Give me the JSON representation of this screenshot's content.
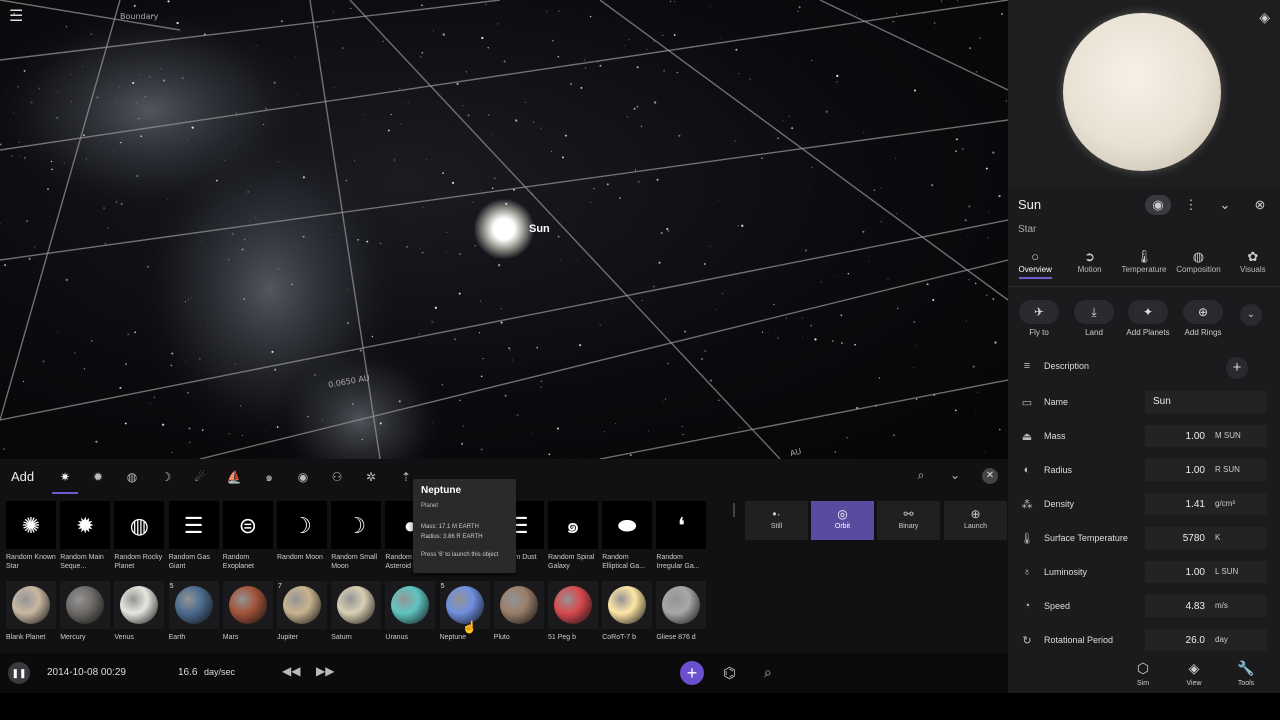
{
  "viewport": {
    "sun_label": "Sun",
    "grid_label_a": "0.0650 AU",
    "grid_label_b": "AU",
    "grid_label_c": "Boundary"
  },
  "panel": {
    "title": "Sun",
    "type": "Star",
    "tabs": [
      {
        "label": "Overview",
        "icon": "circle-icon"
      },
      {
        "label": "Motion",
        "icon": "motion-icon"
      },
      {
        "label": "Temperature",
        "icon": "thermometer-icon"
      },
      {
        "label": "Composition",
        "icon": "composition-icon"
      },
      {
        "label": "Visuals",
        "icon": "palette-icon"
      }
    ],
    "actions": [
      {
        "label": "Fly to",
        "icon": "plane-icon"
      },
      {
        "label": "Land",
        "icon": "land-icon"
      },
      {
        "label": "Add Planets",
        "icon": "add-planets-icon"
      },
      {
        "label": "Add Rings",
        "icon": "add-rings-icon"
      }
    ],
    "description_label": "Description",
    "properties": [
      {
        "label": "Name",
        "value": "Sun",
        "unit": ""
      },
      {
        "label": "Mass",
        "value": "1.00",
        "unit": "M SUN"
      },
      {
        "label": "Radius",
        "value": "1.00",
        "unit": "R SUN"
      },
      {
        "label": "Density",
        "value": "1.41",
        "unit": "g/cm³"
      },
      {
        "label": "Surface Temperature",
        "value": "5780",
        "unit": "K"
      },
      {
        "label": "Luminosity",
        "value": "1.00",
        "unit": "L SUN"
      },
      {
        "label": "Speed",
        "value": "4.83",
        "unit": "m/s"
      },
      {
        "label": "Rotational Period",
        "value": "26.0",
        "unit": "day"
      }
    ]
  },
  "tray": {
    "title": "Add",
    "row1": [
      {
        "label": "Random Known Star",
        "glyph": "✺"
      },
      {
        "label": "Random Main Seque...",
        "glyph": "✹"
      },
      {
        "label": "Random Rocky Planet",
        "glyph": "◍"
      },
      {
        "label": "Random Gas Giant",
        "glyph": "☰"
      },
      {
        "label": "Random Exoplanet",
        "glyph": "⊜"
      },
      {
        "label": "Random Moon",
        "glyph": "☽"
      },
      {
        "label": "Random Small Moon",
        "glyph": "☽"
      },
      {
        "label": "Random Asteroid",
        "glyph": "●"
      },
      {
        "label": "",
        "glyph": ""
      },
      {
        "label": "Random Dust",
        "glyph": "☰"
      },
      {
        "label": "Random Spiral Galaxy",
        "glyph": "๑"
      },
      {
        "label": "Random Elliptical Ga...",
        "glyph": "⬬"
      },
      {
        "label": "Random Irregular Ga...",
        "glyph": "❛"
      }
    ],
    "row2": [
      {
        "label": "Blank Planet",
        "color": "#c9b8a3",
        "num": ""
      },
      {
        "label": "Mercury",
        "color": "#6d6a66",
        "num": ""
      },
      {
        "label": "Venus",
        "color": "#e8e6e0",
        "num": ""
      },
      {
        "label": "Earth",
        "color": "#4b6c8e",
        "num": "5"
      },
      {
        "label": "Mars",
        "color": "#a4533a",
        "num": ""
      },
      {
        "label": "Jupiter",
        "color": "#c9b48e",
        "num": "7"
      },
      {
        "label": "Saturn",
        "color": "#d8cfb3",
        "num": ""
      },
      {
        "label": "Uranus",
        "color": "#5fc6c2",
        "num": ""
      },
      {
        "label": "Neptune",
        "color": "#6f8fe0",
        "num": "5"
      },
      {
        "label": "Pluto",
        "color": "#9a7e6a",
        "num": ""
      },
      {
        "label": "51 Peg b",
        "color": "#d94a4f",
        "num": ""
      },
      {
        "label": "CoRoT-7 b",
        "color": "#ffe7a6",
        "num": ""
      },
      {
        "label": "Gliese 876 d",
        "color": "#a8a8a8",
        "num": ""
      }
    ],
    "modes": [
      {
        "label": "Still",
        "icon": "still-icon"
      },
      {
        "label": "Orbit",
        "icon": "orbit-icon"
      },
      {
        "label": "Binary",
        "icon": "binary-icon"
      },
      {
        "label": "Launch",
        "icon": "launch-icon"
      }
    ],
    "tooltip": {
      "title": "Neptune",
      "subtitle": "Planet",
      "mass": "Mass: 17.1 M EARTH",
      "radius": "Radius: 3.86 R EARTH",
      "hint": "Press '6' to launch this object"
    }
  },
  "bottombar": {
    "date": "2014-10-08 00:29",
    "speed": "16.6",
    "speed_unit": "day/sec",
    "nav": [
      {
        "label": "Sim",
        "icon": "cube-icon"
      },
      {
        "label": "View",
        "icon": "layers-icon"
      },
      {
        "label": "Tools",
        "icon": "wrench-icon"
      }
    ]
  },
  "colors": {
    "accent": "#6a4fcf",
    "panel_bg": "#1b1b1d",
    "tray_bg": "#111113"
  }
}
